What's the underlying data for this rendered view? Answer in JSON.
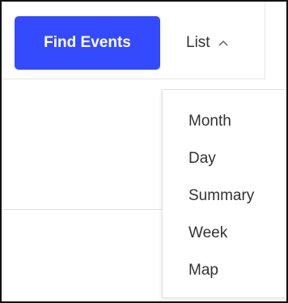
{
  "header": {
    "find_button_label": "Find Events",
    "view_toggle_label": "List",
    "toggle_icon": "chevron-up-icon"
  },
  "view_menu": {
    "items": [
      {
        "label": "Month"
      },
      {
        "label": "Day"
      },
      {
        "label": "Summary"
      },
      {
        "label": "Week"
      },
      {
        "label": "Map"
      }
    ]
  },
  "colors": {
    "button_bg": "#334aff",
    "button_text": "#ffffff",
    "text": "#333333"
  }
}
